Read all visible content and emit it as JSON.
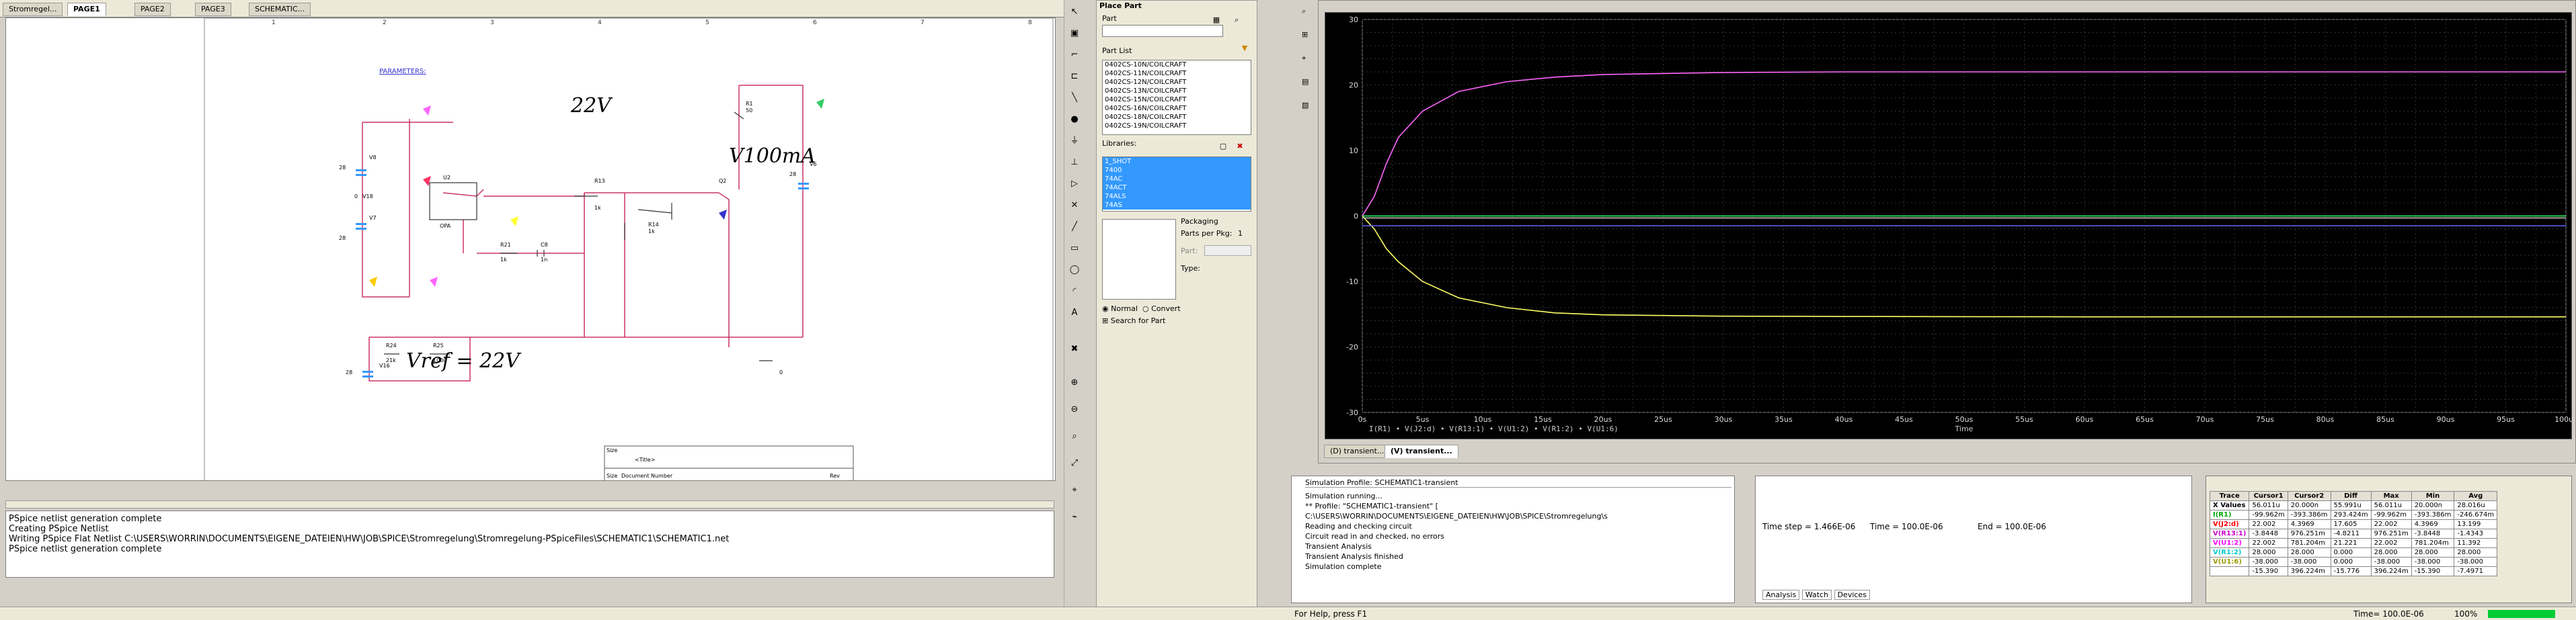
{
  "tabs": [
    {
      "label": "Stromregel..."
    },
    {
      "label": "PAGE1"
    },
    {
      "label": "PAGE2"
    },
    {
      "label": "PAGE3"
    },
    {
      "label": "SCHEMATIC..."
    }
  ],
  "schematic": {
    "params_label": "PARAMETERS:",
    "handwritten": {
      "v22": "22V",
      "v100": "V100mA",
      "vref": "Vref = 22V"
    },
    "components": {
      "r1": "R1",
      "r1v": "50",
      "r13": "R13",
      "r13v": "1k",
      "r14": "R14",
      "r14v": "1k",
      "r21": "R21",
      "r21v": "1k",
      "c8": "C8",
      "c8v": "1n",
      "r24": "R24",
      "r24v": "21k",
      "r25": "R25",
      "r25v": "1000",
      "v6": "V6",
      "v6v": "28",
      "v7": "V7",
      "v7v": "28",
      "v8": "V8",
      "v8v": "28",
      "v16": "V16",
      "v16v": "28",
      "v18": "V18",
      "v18v": "0",
      "u2": "U2",
      "u2m": "OPA",
      "q2": "Q2",
      "zero": "0"
    },
    "title_block": {
      "title": "<Title>",
      "size": "Size",
      "docnum": "Document Number",
      "rev": "Rev"
    },
    "ruler_ticks": [
      "1",
      "2",
      "3",
      "4",
      "5",
      "6",
      "7",
      "8"
    ]
  },
  "console": {
    "lines": [
      "PSpice netlist generation complete",
      "Creating PSpice Netlist",
      "Writing PSpice Flat Netlist C:\\USERS\\WORRIN\\DOCUMENTS\\EIGENE_DATEIEN\\HW\\JOB\\SPICE\\Stromregelung\\Stromregelung-PSpiceFiles\\SCHEMATIC1\\SCHEMATIC1.net",
      "PSpice netlist generation complete"
    ]
  },
  "place_part": {
    "title": "Place Part",
    "part_label": "Part",
    "part_list_label": "Part List",
    "parts": [
      "0402CS-10N/COILCRAFT",
      "0402CS-11N/COILCRAFT",
      "0402CS-12N/COILCRAFT",
      "0402CS-13N/COILCRAFT",
      "0402CS-15N/COILCRAFT",
      "0402CS-16N/COILCRAFT",
      "0402CS-18N/COILCRAFT",
      "0402CS-19N/COILCRAFT"
    ],
    "libraries_label": "Libraries:",
    "libraries": [
      "1_SHOT",
      "7400",
      "74AC",
      "74ACT",
      "74ALS",
      "74AS"
    ],
    "packaging_label": "Packaging",
    "parts_per_pkg_label": "Parts per Pkg:",
    "parts_per_pkg": "1",
    "part_label2": "Part:",
    "type_label": "Type:",
    "normal_label": "Normal",
    "convert_label": "Convert",
    "search_label": "Search for Part"
  },
  "probe": {
    "y_ticks": [
      "30",
      "20",
      "10",
      "0",
      "-10",
      "-20",
      "-30"
    ],
    "x_ticks": [
      "0s",
      "5us",
      "10us",
      "15us",
      "20us",
      "25us",
      "30us",
      "35us",
      "40us",
      "45us",
      "50us",
      "55us",
      "60us",
      "65us",
      "70us",
      "75us",
      "80us",
      "85us",
      "90us",
      "95us",
      "100us"
    ],
    "x_label": "Time",
    "legend": "I(R1) • V(J2:d) • V(R13:1) • V(U1:2) • V(R1:2) • V(U1:6)",
    "tabs": [
      "(D) transient...",
      "(V) transient..."
    ],
    "series_colors": {
      "pink": "#ff66ff",
      "yellow": "#ffff66",
      "green": "#33ff66",
      "blue": "#6666ff",
      "grey": "#c0c0c0"
    }
  },
  "chart_data": {
    "type": "line",
    "xlabel": "Time",
    "ylabel": "",
    "x_unit": "us",
    "xlim": [
      0,
      100
    ],
    "ylim": [
      -30,
      30
    ],
    "grid": true,
    "series": [
      {
        "color": "#ff66ff",
        "x": [
          0,
          1,
          2,
          3,
          5,
          8,
          12,
          16,
          20,
          30,
          40,
          60,
          80,
          100
        ],
        "values": [
          0,
          3,
          8,
          12,
          16,
          19,
          20.5,
          21.2,
          21.6,
          21.9,
          22,
          22,
          22,
          22
        ]
      },
      {
        "color": "#ffff66",
        "x": [
          0,
          1,
          2,
          3,
          5,
          8,
          12,
          16,
          20,
          30,
          40,
          60,
          80,
          100
        ],
        "values": [
          0,
          -2,
          -5,
          -7,
          -10,
          -12.5,
          -14,
          -14.8,
          -15.1,
          -15.3,
          -15.35,
          -15.4,
          -15.4,
          -15.4
        ]
      },
      {
        "color": "#33ff66",
        "x": [
          0,
          100
        ],
        "values": [
          0,
          0
        ]
      },
      {
        "color": "#6666ff",
        "x": [
          0,
          100
        ],
        "values": [
          -1.5,
          -1.5
        ]
      },
      {
        "color": "#c0c0c0",
        "x": [
          0,
          100
        ],
        "values": [
          -0.3,
          -0.3
        ]
      }
    ]
  },
  "sim_output": {
    "header": "Simulation Profile: SCHEMATIC1-transient",
    "lines": [
      "Simulation running...",
      "** Profile: \"SCHEMATIC1-transient\"  [ C:\\USERS\\WORRIN\\DOCUMENTS\\EIGENE_DATEIEN\\HW\\JOB\\SPICE\\Stromregelung\\s",
      "Reading and checking circuit",
      "Circuit read in and checked, no errors",
      "Transient Analysis",
      "Transient Analysis finished",
      "Simulation complete"
    ]
  },
  "time_box": {
    "time_step": "Time step = 1.466E-06",
    "time": "Time = 100.0E-06",
    "end": "End = 100.0E-06",
    "tabs": [
      "Analysis",
      "Watch",
      "Devices"
    ]
  },
  "cursor_table": {
    "headers": [
      "Trace",
      "Cursor1",
      "Cursor2",
      "Diff",
      "Max",
      "Min",
      "Avg"
    ],
    "rows": [
      [
        "X Values",
        "56.011u",
        "20.000n",
        "55.991u",
        "56.011u",
        "20.000n",
        "28.016u"
      ],
      [
        "I(R1)",
        "-99.962m",
        "-393.386m",
        "293.424m",
        "-99.962m",
        "-393.386m",
        "-246.674m"
      ],
      [
        "V(J2:d)",
        "22.002",
        "4.3969",
        "17.605",
        "22.002",
        "4.3969",
        "13.199"
      ],
      [
        "V(R13:1)",
        "-3.8448",
        "976.251m",
        "-4.8211",
        "976.251m",
        "-3.8448",
        "-1.4343"
      ],
      [
        "V(U1:2)",
        "22.002",
        "781.204m",
        "21.221",
        "22.002",
        "781.204m",
        "11.392"
      ],
      [
        "V(R1:2)",
        "28.000",
        "28.000",
        "0.000",
        "28.000",
        "28.000",
        "28.000"
      ],
      [
        "V(U1:6)",
        "-38.000",
        "-38.000",
        "0.000",
        "-38.000",
        "-38.000",
        "-38.000"
      ],
      [
        "",
        "-15.390",
        "396.224m",
        "-15.776",
        "396.224m",
        "-15.390",
        "-7.4971"
      ]
    ]
  },
  "status": {
    "help": "For Help, press F1",
    "time": "Time= 100.0E-06",
    "zoom": "100%"
  }
}
